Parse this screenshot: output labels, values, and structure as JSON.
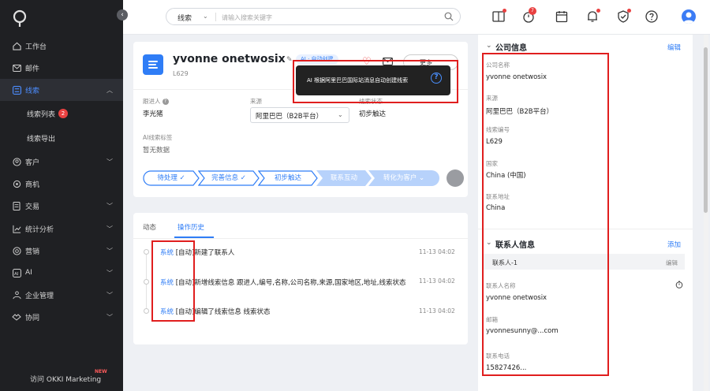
{
  "sidebar": {
    "items": [
      {
        "label": "工作台"
      },
      {
        "label": "邮件"
      },
      {
        "label": "线索"
      },
      {
        "label": "客户"
      },
      {
        "label": "商机"
      },
      {
        "label": "交易"
      },
      {
        "label": "统计分析"
      },
      {
        "label": "营销"
      },
      {
        "label": "AI"
      },
      {
        "label": "企业管理"
      },
      {
        "label": "协同"
      }
    ],
    "sub_items": [
      {
        "label": "线索列表",
        "badge": "2"
      },
      {
        "label": "线索导出"
      }
    ],
    "footer": {
      "label": "访问 OKKI Marketing",
      "badge": "NEW"
    }
  },
  "topbar": {
    "search_scope": "线索",
    "search_placeholder": "请输入搜索关键字",
    "notification_count": "7"
  },
  "lead": {
    "name": "yvonne onetwosix",
    "id": "L629",
    "ai_tag": "AI · 自动创建",
    "action_label": "更多",
    "tooltip": "AI 根据阿里巴巴国际站消息自动创建线索"
  },
  "fields": {
    "owner_label": "跟进人",
    "owner_value": "李光猪",
    "source_label": "来源",
    "source_value": "阿里巴巴（B2B平台）",
    "status_label": "线索状态",
    "status_value": "初步触达",
    "ai_tag_label": "AI线索标签",
    "ai_tag_value": "暂无数据"
  },
  "stages": [
    {
      "label": "待处理 ✓"
    },
    {
      "label": "完善信息 ✓"
    },
    {
      "label": "初步触达"
    },
    {
      "label": "联系互动"
    },
    {
      "label": "转化为客户 ⌄"
    }
  ],
  "activity": {
    "tabs": [
      {
        "label": "动态"
      },
      {
        "label": "操作历史"
      }
    ],
    "rows": [
      {
        "actor": "系统",
        "text": " [自动]新建了联系人",
        "time": "11-13 04:02"
      },
      {
        "actor": "系统",
        "text": " [自动]新增线索信息 跟进人,编号,名称,公司名称,来源,国家地区,地址,线索状态",
        "time": "11-13 04:02"
      },
      {
        "actor": "系统",
        "text": " [自动]编辑了线索信息 线索状态",
        "time": "11-13 04:02"
      }
    ]
  },
  "company": {
    "title": "公司信息",
    "edit_label": "编辑",
    "fields": [
      {
        "label": "公司名称",
        "value": "yvonne onetwosix"
      },
      {
        "label": "来源",
        "value": "阿里巴巴（B2B平台）"
      },
      {
        "label": "线索编号",
        "value": "L629"
      },
      {
        "label": "国家",
        "value": "China (中国)"
      },
      {
        "label": "联系地址",
        "value": "China"
      }
    ]
  },
  "contact": {
    "title": "联系人信息",
    "add_label": "添加",
    "bar_label": "联系人-1",
    "bar_edit": "编辑",
    "fields": [
      {
        "label": "联系人名称",
        "value": "yvonne onetwosix"
      },
      {
        "label": "邮箱",
        "value": "yvonnesunny@...com"
      },
      {
        "label": "联系电话",
        "value": "15827426..."
      }
    ]
  },
  "colors": {
    "accent": "#2f7df6",
    "sidebar_bg": "#1f2023",
    "highlight": "#e01e1e"
  }
}
